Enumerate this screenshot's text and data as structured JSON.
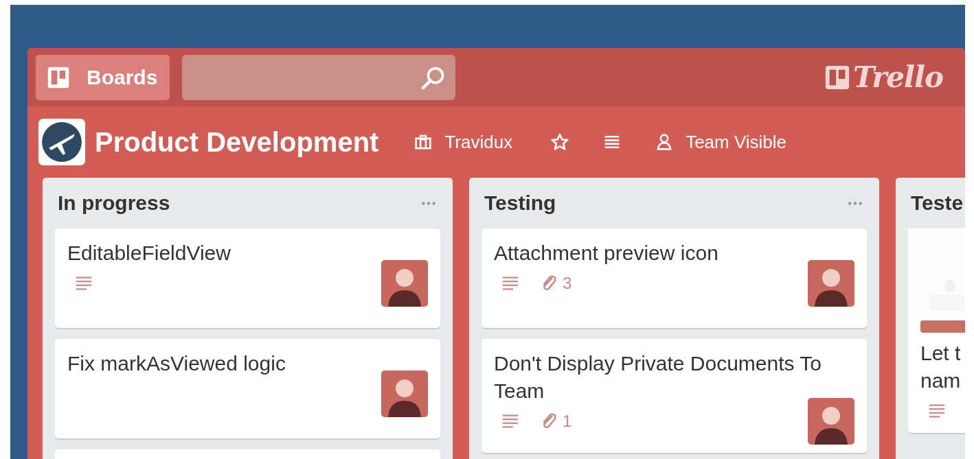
{
  "header": {
    "boards_button": "Boards",
    "logo": "Trello"
  },
  "board": {
    "title": "Product Development",
    "team": "Travidux",
    "starred": false,
    "visibility": "Team Visible"
  },
  "lists": [
    {
      "name": "In progress",
      "more_below": true,
      "cards": [
        {
          "title": "EditableFieldView",
          "description": true,
          "avatar": true
        },
        {
          "title": "Fix markAsViewed logic",
          "description": false,
          "avatar": true
        }
      ]
    },
    {
      "name": "Testing",
      "more_below": false,
      "cards": [
        {
          "title": "Attachment preview icon",
          "description": true,
          "attachments": "3",
          "avatar": true
        },
        {
          "title": "Don't Display Private Documents To Team",
          "description": true,
          "attachments": "1",
          "avatar": true
        }
      ]
    },
    {
      "name": "Teste",
      "more_below": false,
      "cards": [
        {
          "title": "Let t\nnam",
          "cover": true,
          "color": "#c96f63",
          "description": true,
          "avatar": false
        }
      ]
    }
  ]
}
